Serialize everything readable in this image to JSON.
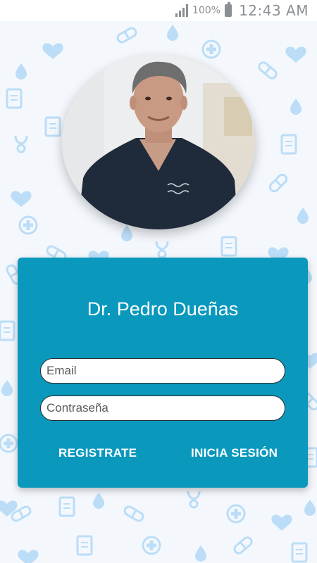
{
  "status_bar": {
    "battery_percent": "100%",
    "time": "12:43 AM",
    "icons": [
      "signal-icon",
      "battery-icon"
    ]
  },
  "profile": {
    "photo_description": "doctor-portrait-avatar"
  },
  "login_card": {
    "title": "Dr. Pedro Dueñas",
    "email_placeholder": "Email",
    "password_placeholder": "Contraseña",
    "register_label": "REGISTRATE",
    "login_label": "INICIA SESIÓN"
  },
  "colors": {
    "card": "#0a98bd",
    "pattern_icon": "#b9dcf7",
    "background": "#f4f8fc"
  }
}
